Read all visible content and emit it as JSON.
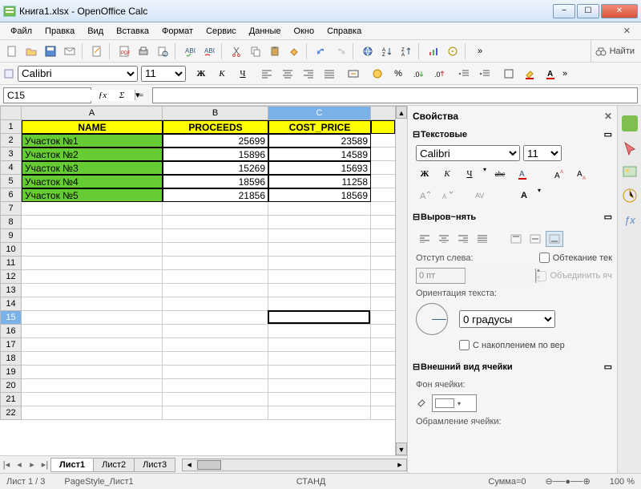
{
  "window": {
    "title": "Книга1.xlsx - OpenOffice Calc"
  },
  "menu": [
    "Файл",
    "Правка",
    "Вид",
    "Вставка",
    "Формат",
    "Сервис",
    "Данные",
    "Окно",
    "Справка"
  ],
  "find_label": "Найти",
  "font_row": {
    "font": "Calibri",
    "size": "11"
  },
  "bold": "Ж",
  "italic": "К",
  "underline": "Ч",
  "name_box": "C15",
  "chart_data": {
    "type": "table",
    "headers": [
      "NAME",
      "PROCEEDS",
      "COST_PRICE"
    ],
    "rows": [
      [
        "Участок №1",
        25699,
        23589
      ],
      [
        "Участок №2",
        15896,
        14589
      ],
      [
        "Участок №3",
        15269,
        15693
      ],
      [
        "Участок №4",
        18596,
        11258
      ],
      [
        "Участок №5",
        21856,
        18569
      ]
    ]
  },
  "columns": [
    "A",
    "B",
    "C"
  ],
  "rowcount": 22,
  "selected_cell": {
    "row": 15,
    "col": "C"
  },
  "cursor_box": {
    "row": 15,
    "col": "C"
  },
  "sheet_tabs": [
    "Лист1",
    "Лист2",
    "Лист3"
  ],
  "active_tab": 0,
  "sidebar": {
    "title": "Свойства",
    "text_section": "Текстовые",
    "font": "Calibri",
    "size": "11",
    "strike": "abc",
    "align_section": "Выров~нять",
    "indent_label": "Отступ слева:",
    "indent_value": "0 пт",
    "wrap_label": "Обтекание тек",
    "merge_label": "Объединить яч",
    "orient_label": "Ориентация текста:",
    "degrees_placeholder": "0 градусы",
    "stacked_label": "С накоплением по вер",
    "cell_section": "Внешний вид ячейки",
    "bg_label": "Фон ячейки:",
    "border_label": "Обрамление ячейки:"
  },
  "status": {
    "sheet": "Лист 1 / 3",
    "pagestyle": "PageStyle_Лист1",
    "mode": "СТАНД",
    "sum": "Сумма=0",
    "zoom": "100 %"
  }
}
